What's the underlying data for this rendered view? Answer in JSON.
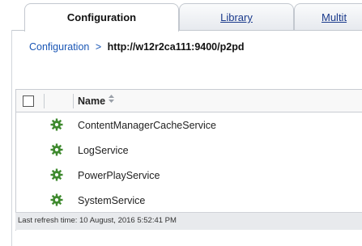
{
  "tabs": [
    {
      "label": "Configuration",
      "active": true
    },
    {
      "label": "Library",
      "active": false
    },
    {
      "label": "Multit",
      "active": false
    }
  ],
  "breadcrumb": {
    "link": "Configuration",
    "separator": ">",
    "current": "http://w12r2ca111:9400/p2pd"
  },
  "table": {
    "column_name": "Name",
    "rows": [
      {
        "label": "ContentManagerCacheService",
        "icon": "gear-icon"
      },
      {
        "label": "LogService",
        "icon": "gear-icon"
      },
      {
        "label": "PowerPlayService",
        "icon": "gear-icon"
      },
      {
        "label": "SystemService",
        "icon": "gear-icon"
      }
    ]
  },
  "status": {
    "text": "Last refresh time: 10 August, 2016 5:52:41 PM"
  },
  "colors": {
    "gear": "#3f8a2f",
    "link": "#1a56b5"
  }
}
